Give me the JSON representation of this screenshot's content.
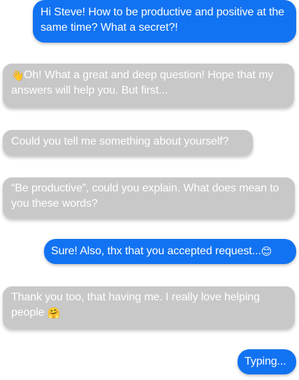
{
  "conversation": {
    "messages": [
      {
        "sender": "me",
        "text": "Hi Steve! How to be productive and positive at the same time? What a secret?!"
      },
      {
        "sender": "steve",
        "emoji": "👋",
        "text": "Oh! What a great and deep question! Hope that my answers will help you. But first..."
      },
      {
        "sender": "steve",
        "text": "Could you tell me something about yourself?"
      },
      {
        "sender": "steve",
        "text": "“Be productive”, could you explain. What does mean to you these words?"
      },
      {
        "sender": "me",
        "text": "Sure! Also, thx that you accepted request...",
        "emoji": "😊"
      },
      {
        "sender": "steve",
        "text": "Thank you too, that having me. I really love helping people",
        "emoji": "🤗"
      },
      {
        "sender": "me",
        "text": "Typing..."
      }
    ]
  },
  "colors": {
    "outgoing_bubble": "#1273f2",
    "incoming_bubble": "#c8c8c8",
    "bubble_text": "#ffffff",
    "background": "#ffffff"
  }
}
